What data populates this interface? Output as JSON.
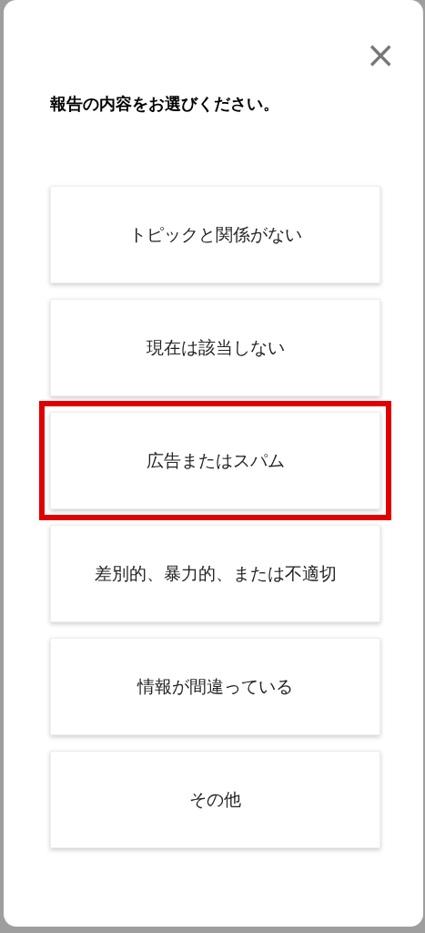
{
  "dialog": {
    "close": "×",
    "title": "報告の内容をお選びください。",
    "options": [
      {
        "label": "トピックと関係がない",
        "highlighted": false
      },
      {
        "label": "現在は該当しない",
        "highlighted": false
      },
      {
        "label": "広告またはスパム",
        "highlighted": true
      },
      {
        "label": "差別的、暴力的、または不適切",
        "highlighted": false
      },
      {
        "label": "情報が間違っている",
        "highlighted": false
      },
      {
        "label": "その他",
        "highlighted": false
      }
    ]
  }
}
